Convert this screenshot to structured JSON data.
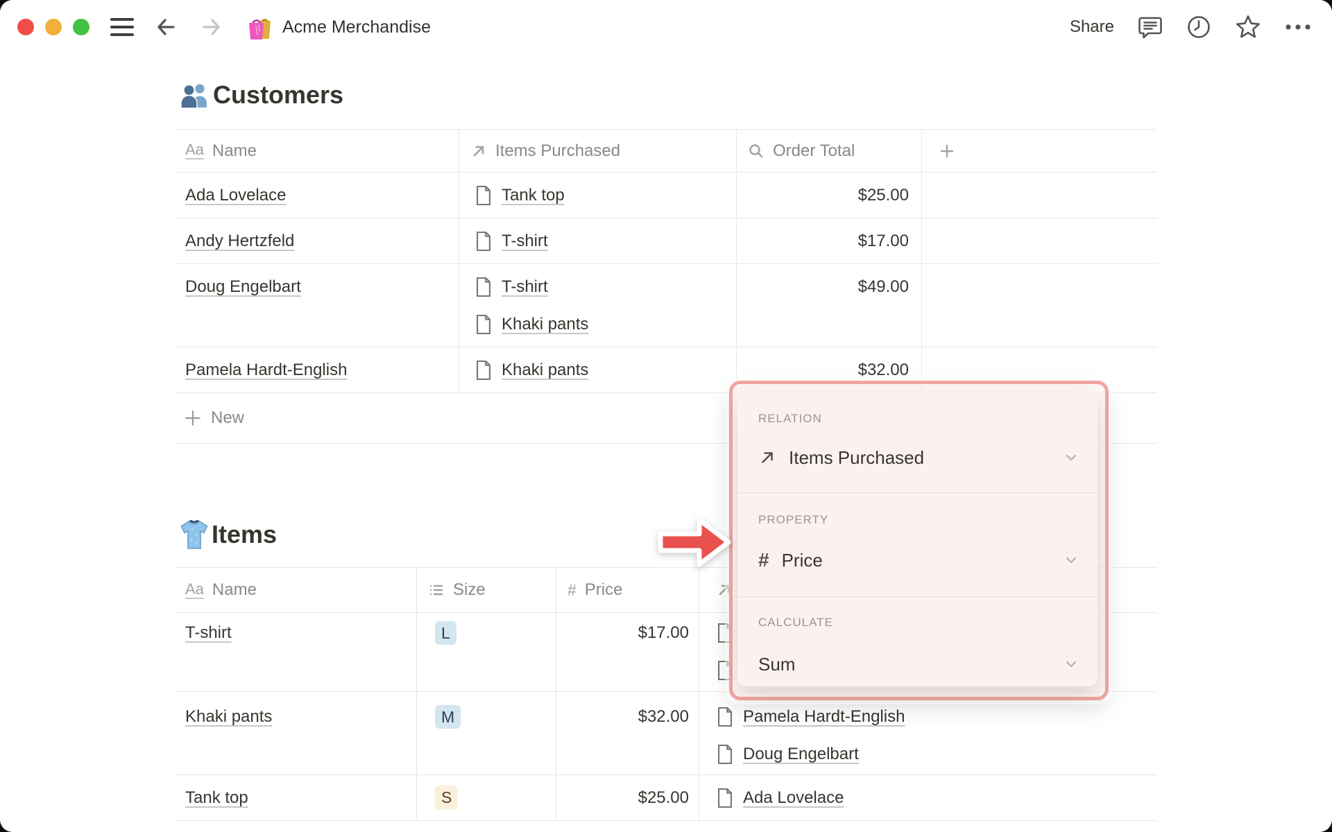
{
  "window": {
    "title": "Acme Merchandise",
    "share_label": "Share"
  },
  "customers": {
    "title": "Customers",
    "columns": [
      {
        "icon": "text-icon",
        "label": "Name"
      },
      {
        "icon": "arrow-up-right-icon",
        "label": "Items Purchased"
      },
      {
        "icon": "search-icon",
        "label": "Order Total"
      },
      {
        "icon": "plus-icon",
        "label": ""
      }
    ],
    "rows": [
      {
        "name": "Ada Lovelace",
        "items": [
          "Tank top"
        ],
        "total": "$25.00"
      },
      {
        "name": "Andy Hertzfeld",
        "items": [
          "T-shirt"
        ],
        "total": "$17.00"
      },
      {
        "name": "Doug Engelbart",
        "items": [
          "T-shirt",
          "Khaki pants"
        ],
        "total": "$49.00"
      },
      {
        "name": "Pamela Hardt-English",
        "items": [
          "Khaki pants"
        ],
        "total": "$32.00"
      }
    ],
    "new_label": "New"
  },
  "items": {
    "title": "Items",
    "columns": [
      {
        "icon": "text-icon",
        "label": "Name"
      },
      {
        "icon": "list-icon",
        "label": "Size"
      },
      {
        "icon": "hash-icon",
        "label": "Price"
      },
      {
        "icon": "arrow-up-right-icon",
        "label": ""
      }
    ],
    "rows": [
      {
        "name": "T-shirt",
        "size": "L",
        "size_color": "blue",
        "price": "$17.00",
        "purchasers": [
          "",
          ""
        ]
      },
      {
        "name": "Khaki pants",
        "size": "M",
        "size_color": "blue",
        "price": "$32.00",
        "purchasers": [
          "Pamela Hardt-English",
          "Doug Engelbart"
        ]
      },
      {
        "name": "Tank top",
        "size": "S",
        "size_color": "yellow",
        "price": "$25.00",
        "purchasers": [
          "Ada Lovelace"
        ]
      }
    ]
  },
  "popup": {
    "relation_label": "RELATION",
    "relation_value": "Items Purchased",
    "property_label": "PROPERTY",
    "property_value": "Price",
    "calculate_label": "CALCULATE",
    "calculate_value": "Sum"
  },
  "colors": {
    "accent_red": "#e9514d",
    "popup_bg": "#fdf1ef",
    "popup_ring": "#f1a6a0",
    "badge_blue_bg": "#d3e5ef",
    "badge_yellow_bg": "#faf0dc",
    "table_border": "#e8e7e5",
    "text_main": "#37352f",
    "text_gray": "#8b8983"
  }
}
